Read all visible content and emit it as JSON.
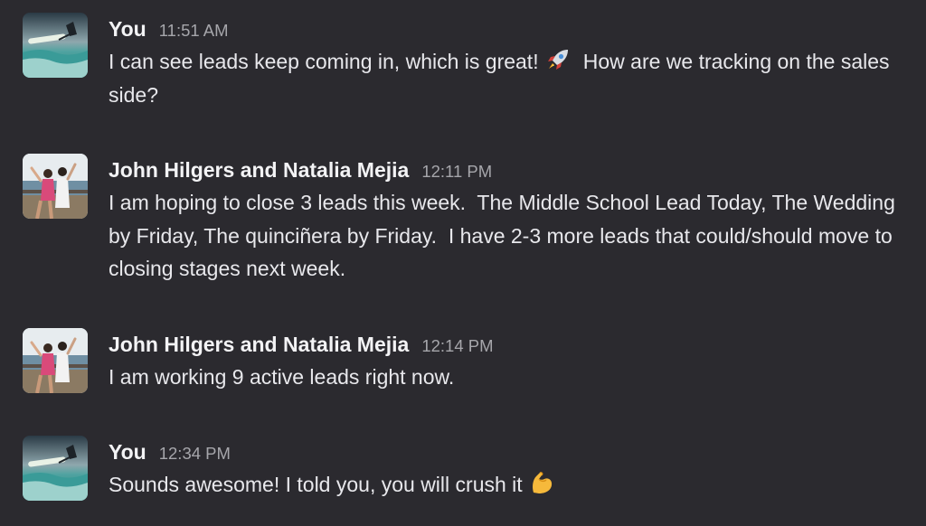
{
  "messages": [
    {
      "sender": "You",
      "time": "11:51 AM",
      "avatar": "surfer-avatar",
      "text_before": "I can see leads keep coming in, which is great! ",
      "emoji": "rocket-emoji",
      "text_after": "  How are we tracking on the sales side?"
    },
    {
      "sender": "John Hilgers and Natalia Mejia",
      "time": "12:11 PM",
      "avatar": "couple-beach-avatar",
      "text": "I am hoping to close 3 leads this week.  The Middle School Lead Today, The Wedding by Friday, The quinciñera by Friday.  I have 2-3 more leads that could/should move to closing stages next week."
    },
    {
      "sender": "John Hilgers and Natalia Mejia",
      "time": "12:14 PM",
      "avatar": "couple-beach-avatar",
      "text": "I am working 9 active leads right now."
    },
    {
      "sender": "You",
      "time": "12:34 PM",
      "avatar": "surfer-avatar",
      "text_before": "Sounds awesome! I told you, you will crush it ",
      "emoji": "flexed-biceps-emoji"
    }
  ],
  "colors": {
    "background": "#2b2a2f",
    "text": "#e8e8ec",
    "timestamp": "#a6a6ab"
  }
}
